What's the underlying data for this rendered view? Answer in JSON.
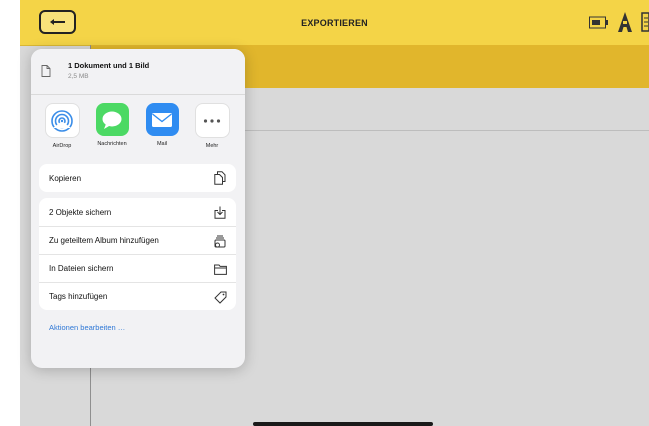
{
  "topbar": {
    "title": "EXPORTIEREN"
  },
  "share_sheet": {
    "title": "1 Dokument und 1 Bild",
    "subtitle": "2,5 MB",
    "apps": [
      {
        "label": "AirDrop",
        "icon": "airdrop-icon"
      },
      {
        "label": "Nachrichten",
        "icon": "messages-icon"
      },
      {
        "label": "Mail",
        "icon": "mail-icon"
      },
      {
        "label": "Mehr",
        "icon": "more-icon"
      }
    ],
    "copy_label": "Kopieren",
    "actions": [
      {
        "label": "2 Objekte sichern",
        "icon": "save-download-icon"
      },
      {
        "label": "Zu geteiltem Album hinzufügen",
        "icon": "shared-album-icon"
      },
      {
        "label": "In Dateien sichern",
        "icon": "folder-icon"
      },
      {
        "label": "Tags hinzufügen",
        "icon": "tag-icon"
      }
    ],
    "edit_actions_label": "Aktionen bearbeiten …"
  },
  "colors": {
    "accent": "#f4d447",
    "band": "#e1b62c",
    "link": "#2f78d6"
  }
}
